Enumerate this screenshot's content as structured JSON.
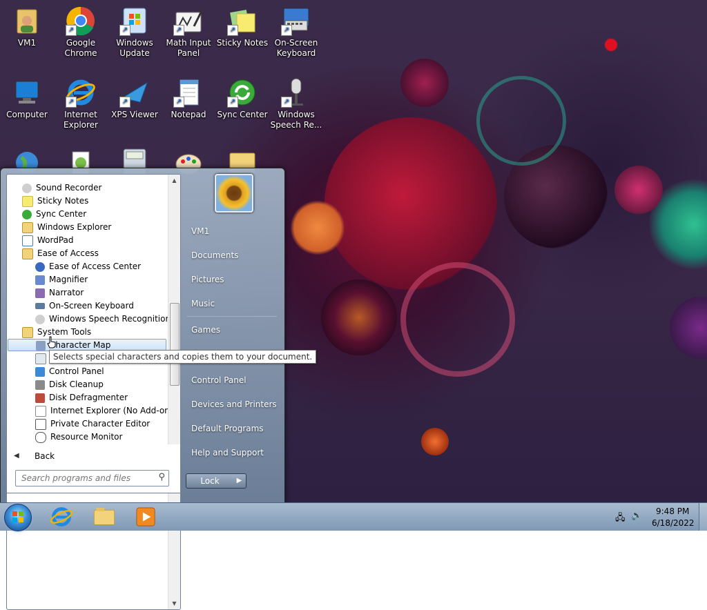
{
  "desktop": {
    "icons": [
      {
        "label1": "VM1",
        "label2": "",
        "icon": "user-folder-icon"
      },
      {
        "label1": "Google",
        "label2": "Chrome",
        "icon": "chrome-icon"
      },
      {
        "label1": "Windows",
        "label2": "Update",
        "icon": "windows-update-icon"
      },
      {
        "label1": "Math Input",
        "label2": "Panel",
        "icon": "math-input-icon"
      },
      {
        "label1": "Sticky Notes",
        "label2": "",
        "icon": "sticky-notes-icon"
      },
      {
        "label1": "On-Screen",
        "label2": "Keyboard",
        "icon": "keyboard-icon"
      },
      {
        "label1": "Computer",
        "label2": "",
        "icon": "computer-icon"
      },
      {
        "label1": "Internet",
        "label2": "Explorer",
        "icon": "ie-icon"
      },
      {
        "label1": "XPS Viewer",
        "label2": "",
        "icon": "xps-viewer-icon"
      },
      {
        "label1": "Notepad",
        "label2": "",
        "icon": "notepad-icon"
      },
      {
        "label1": "Sync Center",
        "label2": "",
        "icon": "sync-center-icon"
      },
      {
        "label1": "Windows",
        "label2": "Speech Re...",
        "icon": "microphone-icon"
      }
    ]
  },
  "start_menu": {
    "programs": [
      {
        "label": "Sound Recorder",
        "icon": "microphone-icon"
      },
      {
        "label": "Sticky Notes",
        "icon": "sticky-notes-icon"
      },
      {
        "label": "Sync Center",
        "icon": "sync-center-icon"
      },
      {
        "label": "Windows Explorer",
        "icon": "folder-icon"
      },
      {
        "label": "WordPad",
        "icon": "wordpad-icon"
      },
      {
        "label": "Ease of Access",
        "icon": "folder-icon"
      },
      {
        "label": "Ease of Access Center",
        "icon": "ease-of-access-icon"
      },
      {
        "label": "Magnifier",
        "icon": "magnifier-icon"
      },
      {
        "label": "Narrator",
        "icon": "narrator-icon"
      },
      {
        "label": "On-Screen Keyboard",
        "icon": "keyboard-icon"
      },
      {
        "label": "Windows Speech Recognition",
        "icon": "microphone-icon"
      },
      {
        "label": "System Tools",
        "icon": "folder-icon"
      },
      {
        "label": "Character Map",
        "icon": "character-map-icon"
      },
      {
        "label": "",
        "icon": "computer-icon"
      },
      {
        "label": "Control Panel",
        "icon": "control-panel-icon"
      },
      {
        "label": "Disk Cleanup",
        "icon": "disk-cleanup-icon"
      },
      {
        "label": "Disk Defragmenter",
        "icon": "defrag-icon"
      },
      {
        "label": "Internet Explorer (No Add-ons)",
        "icon": "ie-icon"
      },
      {
        "label": "Private Character Editor",
        "icon": "character-editor-icon"
      },
      {
        "label": "Resource Monitor",
        "icon": "resource-monitor-icon"
      }
    ],
    "selected_program": "Character Map",
    "tooltip": "Selects special characters and copies them to your document.",
    "back_label": "Back",
    "search_placeholder": "Search programs and files",
    "right_links": [
      "VM1",
      "Documents",
      "Pictures",
      "Music",
      "Games",
      "Control Panel",
      "Devices and Printers",
      "Default Programs",
      "Help and Support"
    ],
    "lock_label": "Lock"
  },
  "taskbar": {
    "pinned": [
      "internet-explorer-icon",
      "windows-explorer-icon",
      "media-player-icon"
    ],
    "time": "9:48 PM",
    "date": "6/18/2022"
  }
}
